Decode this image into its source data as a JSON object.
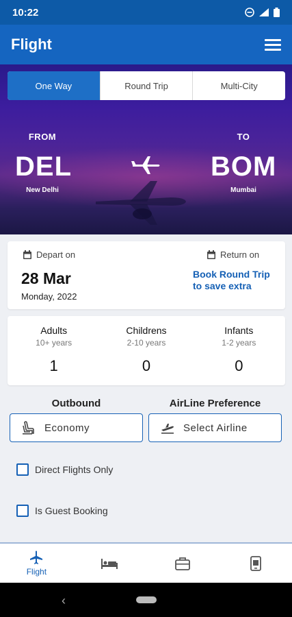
{
  "status_bar": {
    "time": "10:22"
  },
  "app_bar": {
    "title": "Flight"
  },
  "trip_tabs": [
    {
      "label": "One Way",
      "active": true
    },
    {
      "label": "Round Trip",
      "active": false
    },
    {
      "label": "Multi-City",
      "active": false
    }
  ],
  "route": {
    "from_label": "FROM",
    "from_code": "DEL",
    "from_city": "New Delhi",
    "to_label": "TO",
    "to_code": "BOM",
    "to_city": "Mumbai"
  },
  "dates": {
    "depart_label": "Depart on",
    "depart_date": "28 Mar",
    "depart_sub": "Monday, 2022",
    "return_label": "Return on",
    "round_trip_line1": "Book Round Trip",
    "round_trip_line2": "to save extra"
  },
  "passengers": [
    {
      "title": "Adults",
      "sub": "10+ years",
      "count": "1"
    },
    {
      "title": "Childrens",
      "sub": "2-10 years",
      "count": "0"
    },
    {
      "title": "Infants",
      "sub": "1-2 years",
      "count": "0"
    }
  ],
  "preferences": {
    "outbound_title": "Outbound",
    "cabin_value": "Economy",
    "airline_title": "AirLine Preference",
    "airline_placeholder": "Select Airline"
  },
  "options": {
    "direct_only": "Direct Flights Only",
    "guest_booking": "Is Guest Booking"
  },
  "bottom_nav": [
    {
      "label": "Flight",
      "icon": "flight-icon",
      "active": true
    },
    {
      "label": "",
      "icon": "hotel-icon",
      "active": false
    },
    {
      "label": "",
      "icon": "holiday-briefcase-icon",
      "active": false
    },
    {
      "label": "",
      "icon": "mobile-recharge-icon",
      "active": false
    }
  ],
  "colors": {
    "primary": "#1565c0",
    "status_bar": "#0d5aa7",
    "accent_link": "#1560b5"
  }
}
